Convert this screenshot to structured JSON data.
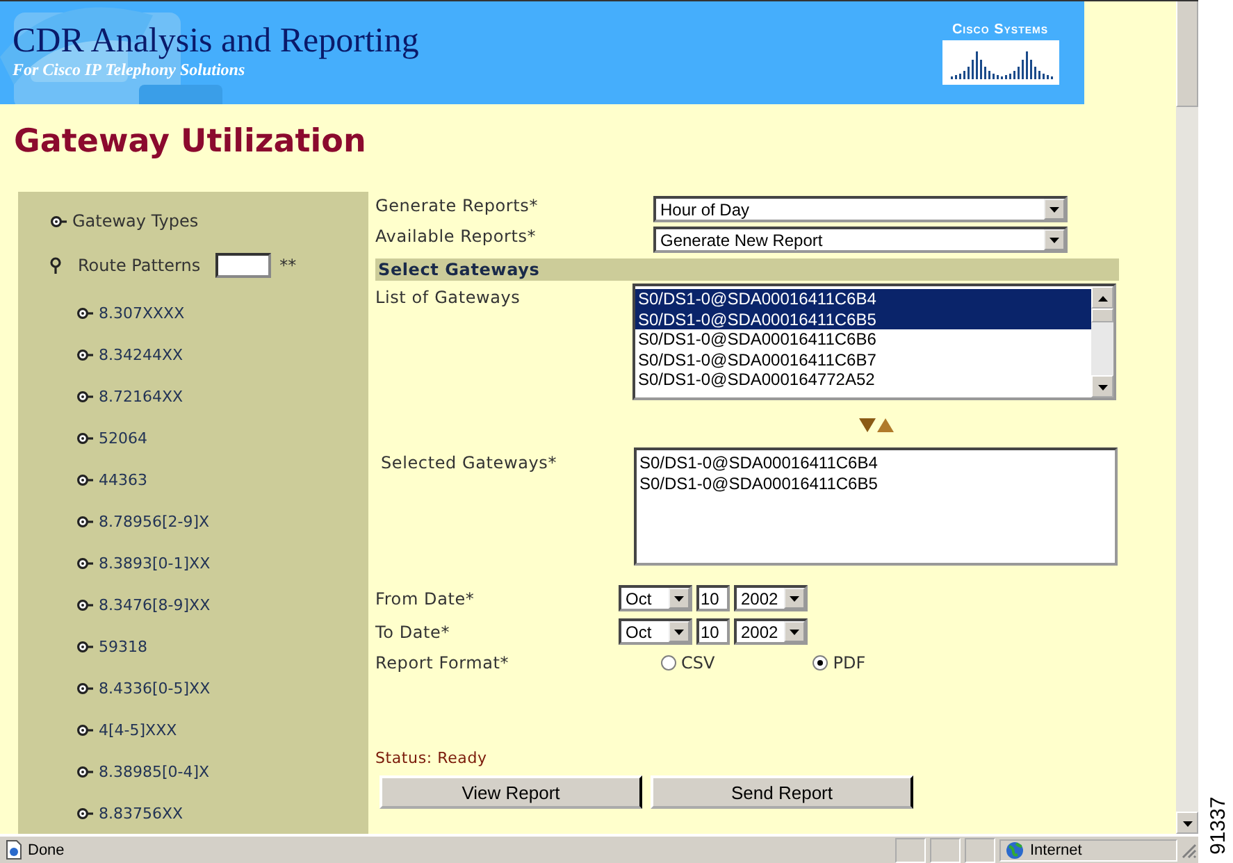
{
  "banner": {
    "title": "CDR Analysis and Reporting",
    "subtitle": "For Cisco IP Telephony Solutions",
    "logo_text": "Cisco Systems"
  },
  "page_title": "Gateway Utilization",
  "sidebar": {
    "items": [
      {
        "label": "Gateway Types",
        "expanded": false
      },
      {
        "label": "Route Patterns",
        "expanded": true,
        "field": true,
        "note": "**",
        "children": [
          {
            "label": "8.307XXXX",
            "expanded": false
          },
          {
            "label": "8.34244XX",
            "expanded": false
          },
          {
            "label": "8.72164XX",
            "expanded": false
          },
          {
            "label": "52064",
            "expanded": false
          },
          {
            "label": "44363",
            "expanded": false
          },
          {
            "label": "8.78956[2-9]X",
            "expanded": false
          },
          {
            "label": "8.3893[0-1]XX",
            "expanded": false
          },
          {
            "label": "8.3476[8-9]XX",
            "expanded": false
          },
          {
            "label": "59318",
            "expanded": false
          },
          {
            "label": "8.4336[0-5]XX",
            "expanded": false
          },
          {
            "label": "4[4-5]XXX",
            "expanded": false
          },
          {
            "label": "8.38985[0-4]X",
            "expanded": false
          },
          {
            "label": "8.83756XX",
            "expanded": false
          }
        ]
      }
    ]
  },
  "form": {
    "generate_reports": {
      "label": "Generate Reports*",
      "value": "Hour of Day"
    },
    "available_reports": {
      "label": "Available Reports*",
      "value": "Generate New Report"
    },
    "section_title": "Select Gateways",
    "gateway_list": {
      "label": "List of Gateways",
      "options": [
        {
          "label": "S0/DS1-0@SDA00016411C6B4",
          "selected": true
        },
        {
          "label": "S0/DS1-0@SDA00016411C6B5",
          "selected": true
        },
        {
          "label": "S0/DS1-0@SDA00016411C6B6",
          "selected": false
        },
        {
          "label": "S0/DS1-0@SDA00016411C6B7",
          "selected": false
        },
        {
          "label": "S0/DS1-0@SDA000164772A52",
          "selected": false
        }
      ]
    },
    "selected_gateways": {
      "label": "Selected Gateways*",
      "items": [
        "S0/DS1-0@SDA00016411C6B4",
        "S0/DS1-0@SDA00016411C6B5"
      ]
    },
    "from_date": {
      "label": "From Date*",
      "month": "Oct",
      "day": "10",
      "year": "2002"
    },
    "to_date": {
      "label": "To Date*",
      "month": "Oct",
      "day": "10",
      "year": "2002"
    },
    "report_format": {
      "label": "Report Format*",
      "options": [
        {
          "label": "CSV",
          "selected": false
        },
        {
          "label": "PDF",
          "selected": true
        }
      ]
    },
    "status": "Status: Ready",
    "buttons": [
      "View Report",
      "Send Report"
    ]
  },
  "status_bar": {
    "text": "Done",
    "zone": "Internet"
  },
  "figure_number": "91337"
}
